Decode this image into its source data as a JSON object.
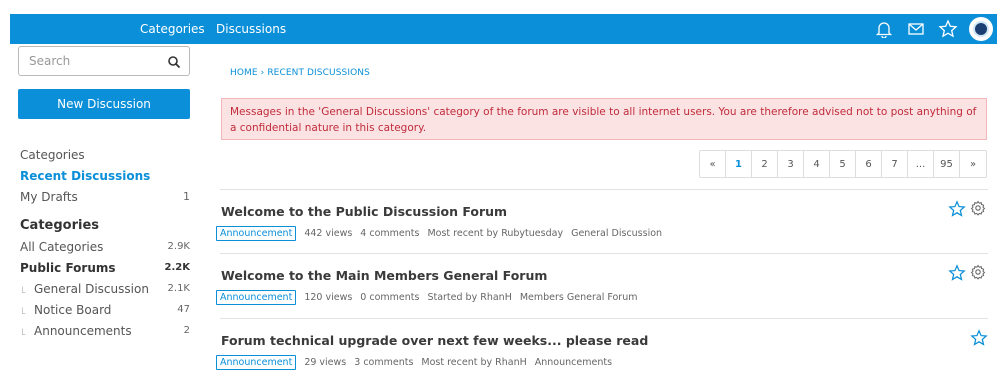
{
  "topbar": {
    "nav": [
      "Categories",
      "Discussions"
    ],
    "icons": [
      "bell-icon",
      "mail-icon",
      "star-icon",
      "avatar"
    ],
    "color": "#0a8fd8"
  },
  "sidebar": {
    "search_placeholder": "Search",
    "new_discussion": "New Discussion",
    "menu": [
      {
        "label": "Categories",
        "count": ""
      },
      {
        "label": "Recent Discussions",
        "count": ""
      },
      {
        "label": "My Drafts",
        "count": "1"
      }
    ],
    "categories_heading": "Categories",
    "categories": [
      {
        "label": "All Categories",
        "count": "2.9K"
      },
      {
        "label": "Public Forums",
        "count": "2.2K"
      },
      {
        "label": "General Discussion",
        "count": "2.1K"
      },
      {
        "label": "Notice Board",
        "count": "47"
      },
      {
        "label": "Announcements",
        "count": "2"
      }
    ]
  },
  "main": {
    "breadcrumb": "HOME › RECENT DISCUSSIONS",
    "alert": "Messages in the 'General Discussions' category of the forum are visible to all internet users. You are therefore advised not to post anything of a confidential nature in this category.",
    "pager": [
      "«",
      "1",
      "2",
      "3",
      "4",
      "5",
      "6",
      "7",
      "...",
      "95",
      "»"
    ],
    "discussions": [
      {
        "title": "Welcome to the Public Discussion Forum",
        "badge": "Announcement",
        "views": "442 views",
        "comments": "4 comments",
        "recent": "Most recent by Rubytuesday",
        "category": "General Discussion"
      },
      {
        "title": "Welcome to the Main Members General Forum",
        "badge": "Announcement",
        "views": "120 views",
        "comments": "0 comments",
        "recent": "Started by RhanH",
        "category": "Members General Forum"
      },
      {
        "title": "Forum technical upgrade over next few weeks... please read",
        "badge": "Announcement",
        "views": "29 views",
        "comments": "3 comments",
        "recent": "Most recent by RhanH",
        "category": "Announcements"
      }
    ]
  }
}
